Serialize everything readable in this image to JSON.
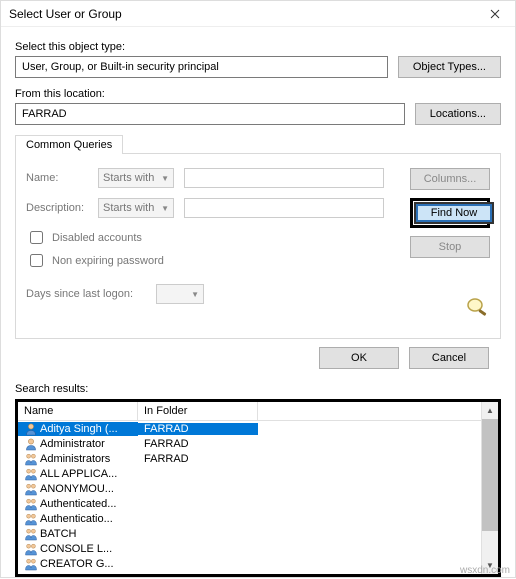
{
  "title": "Select User or Group",
  "object_type_label": "Select this object type:",
  "object_type_value": "User, Group, or Built-in security principal",
  "object_types_btn": "Object Types...",
  "location_label": "From this location:",
  "location_value": "FARRAD",
  "locations_btn": "Locations...",
  "tab": "Common Queries",
  "query": {
    "name_label": "Name:",
    "name_mode": "Starts with",
    "desc_label": "Description:",
    "desc_mode": "Starts with",
    "disabled": "Disabled accounts",
    "nonexpire": "Non expiring password",
    "days_label": "Days since last logon:"
  },
  "buttons": {
    "columns": "Columns...",
    "findnow": "Find Now",
    "stop": "Stop",
    "ok": "OK",
    "cancel": "Cancel"
  },
  "results_label": "Search results:",
  "columns": {
    "name": "Name",
    "folder": "In Folder"
  },
  "results": [
    {
      "name": "Aditya Singh (...",
      "folder": "FARRAD",
      "icon": "user",
      "selected": true
    },
    {
      "name": "Administrator",
      "folder": "FARRAD",
      "icon": "user"
    },
    {
      "name": "Administrators",
      "folder": "FARRAD",
      "icon": "group"
    },
    {
      "name": "ALL APPLICA...",
      "folder": "",
      "icon": "group"
    },
    {
      "name": "ANONYMOU...",
      "folder": "",
      "icon": "group"
    },
    {
      "name": "Authenticated...",
      "folder": "",
      "icon": "group"
    },
    {
      "name": "Authenticatio...",
      "folder": "",
      "icon": "group"
    },
    {
      "name": "BATCH",
      "folder": "",
      "icon": "group"
    },
    {
      "name": "CONSOLE L...",
      "folder": "",
      "icon": "group"
    },
    {
      "name": "CREATOR G...",
      "folder": "",
      "icon": "group"
    }
  ],
  "watermark": "wsxdn.com"
}
